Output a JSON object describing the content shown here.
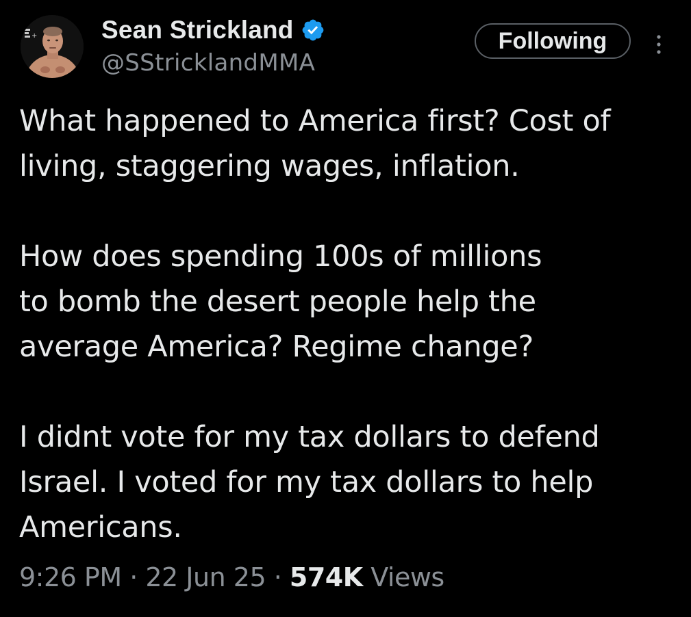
{
  "author": {
    "display_name": "Sean Strickland",
    "handle": "@SStricklandMMA",
    "verified": true,
    "verified_color": "#1d9bf0"
  },
  "follow_button": {
    "label": "Following"
  },
  "more_menu": {
    "icon": "more-vertical-icon"
  },
  "tweet": {
    "paragraphs": [
      {
        "lines": [
          "What happened to America first? Cost of",
          "living, staggering wages, inflation."
        ]
      },
      {
        "lines": [
          "How does spending 100s of millions",
          "to bomb the desert people help the",
          "average America? Regime change?"
        ]
      },
      {
        "lines": [
          "I didnt vote for my tax dollars to defend",
          "Israel. I voted for my tax dollars to help",
          "Americans."
        ]
      }
    ]
  },
  "meta": {
    "time": "9:26 PM",
    "separator": " · ",
    "date": "22 Jun 25",
    "views_count": "574K",
    "views_label": "Views"
  },
  "colors": {
    "background": "#000000",
    "text_primary": "#e7e9ea",
    "text_secondary": "#8b9096",
    "button_border": "#5b6066"
  }
}
